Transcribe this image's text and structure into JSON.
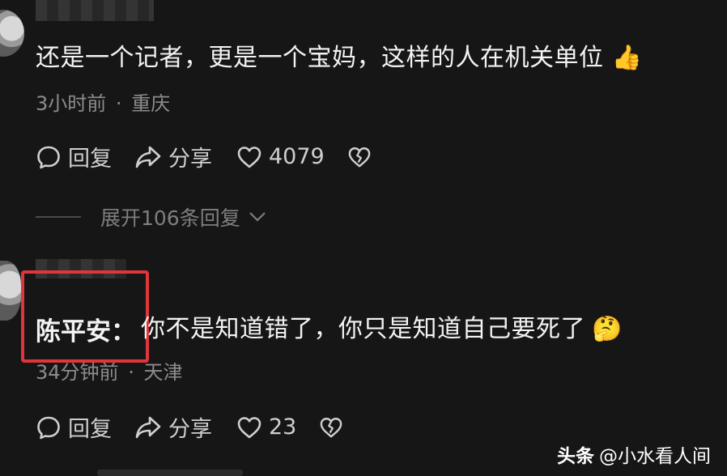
{
  "comments": [
    {
      "text": "还是一个记者，更是一个宝妈，这样的人在机关单位",
      "emoji": "👍",
      "time": "3小时前",
      "separator": "·",
      "location": "重庆",
      "reply_label": "回复",
      "share_label": "分享",
      "like_count": "4079",
      "expand_label": "展开106条回复"
    },
    {
      "username": "陈平安：",
      "text": "你不是知道错了，你只是知道自己要死了",
      "emoji": "🤔",
      "time": "34分钟前",
      "separator": "·",
      "location": "天津",
      "reply_label": "回复",
      "share_label": "分享",
      "like_count": "23"
    }
  ],
  "watermark": {
    "logo": "头条",
    "account": "@小水看人间"
  },
  "colors": {
    "background": "#161616",
    "highlight": "#e0353a",
    "emoji_yellow": "#f5b21f"
  }
}
